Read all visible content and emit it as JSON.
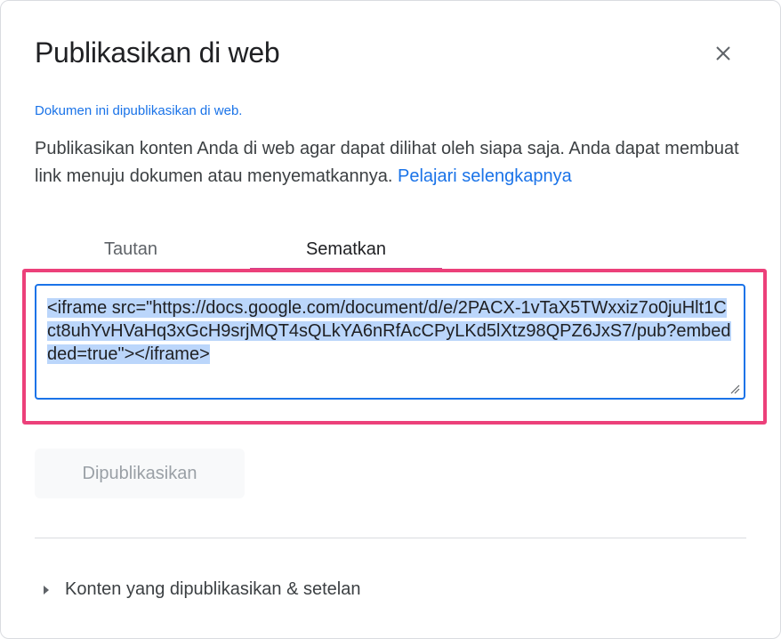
{
  "dialog": {
    "title": "Publikasikan di web",
    "status_text": "Dokumen ini dipublikasikan di web.",
    "description": "Publikasikan konten Anda di web agar dapat dilihat oleh siapa saja. Anda dapat membuat link menuju dokumen atau menyematkannya.",
    "learn_more_link": "Pelajari selengkapnya",
    "close_icon": "close-icon"
  },
  "tabs": [
    {
      "label": "Tautan",
      "active": false
    },
    {
      "label": "Sematkan",
      "active": true
    }
  ],
  "embed": {
    "code": "<iframe src=\"https://docs.google.com/document/d/e/2PACX-1vTaX5TWxxiz7o0juHlt1Cct8uhYvHVaHq3xGcH9srjMQT4sQLkYA6nRfAcCPyLKd5lXtz98QPZ6JxS7/pub?embedded=true\"></iframe>",
    "selected": true
  },
  "publish_button": {
    "label": "Dipublikasikan",
    "disabled": true
  },
  "settings_section": {
    "label": "Konten yang dipublikasikan & setelan",
    "expanded": false,
    "icon": "caret-right-icon"
  },
  "colors": {
    "accent": "#1a73e8",
    "highlight": "#ec407a",
    "tab_underline": "#d23f8a",
    "selection": "#bbd6fb"
  }
}
